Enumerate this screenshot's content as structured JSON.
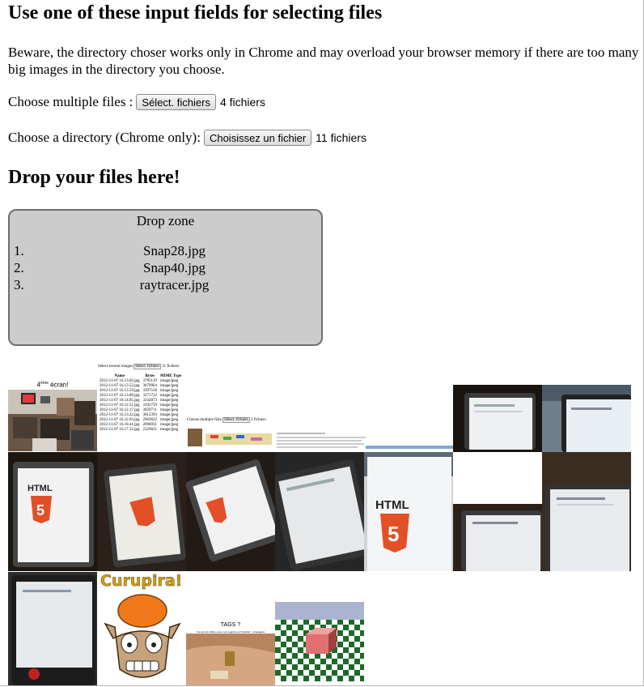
{
  "heading": "Use one of these input fields for selecting files",
  "warning": "Beware, the directory choser works only in Chrome and may overload your browser memory if there are too many big images in the directory you choose.",
  "multi": {
    "label": "Choose multiple files :",
    "button": "Sélect. fichiers",
    "count": "4 fichiers"
  },
  "dir": {
    "label": "Choose a directory (Chrome only):",
    "button": "Choisissez un fichier",
    "count": "11 fichiers"
  },
  "drop_heading": "Drop your files here!",
  "dropzone": {
    "title": "Drop zone",
    "files": [
      "Snap28.jpg",
      "Snap40.jpg",
      "raytracer.jpg"
    ]
  },
  "thumbnails": {
    "ecran": {
      "caption_pre": "4",
      "caption_sup": "ème",
      "caption_post": " écran!"
    },
    "table": {
      "top_label": "Select several images",
      "top_button": "Sélect. fichiers",
      "top_count": "11 fichiers",
      "headers": [
        "Name",
        "Bytes",
        "MIME Type"
      ],
      "rows": [
        [
          "2012-11-07 16.13.02.jpg",
          "3795119",
          "image/jpeg"
        ],
        [
          "2012-11-07 16.13.52.jpg",
          "3679964",
          "image/jpeg"
        ],
        [
          "2012-11-07 16.13.59.jpg",
          "3397518",
          "image/jpeg"
        ],
        [
          "2012-11-07 16.13.00.jpg",
          "3271722",
          "image/jpeg"
        ],
        [
          "2012-11-07 16.14.05.jpg",
          "3242873",
          "image/jpeg"
        ],
        [
          "2012-11-07 16.12.51.jpg",
          "3192759",
          "image/jpeg"
        ],
        [
          "2012-11-07 16.12.17.jpg",
          "3059711",
          "image/jpeg"
        ],
        [
          "2012-11-07 16.13.22.jpg",
          "3012393",
          "image/jpeg"
        ],
        [
          "2012-11-07 16.12.03.jpg",
          "2963622",
          "image/jpeg"
        ],
        [
          "2012-11-07 16.18.41.jpg",
          "2696931",
          "image/jpeg"
        ],
        [
          "2012-11-07 16.17.22.jpg",
          "2329621",
          "image/jpeg"
        ]
      ]
    },
    "choose": {
      "label": "Choose multiple files",
      "button": "Sélect. fichiers",
      "count": "2 fichiers"
    },
    "html5_label": "HTML",
    "curupira": "Curupira!",
    "tags": "TAGS ?",
    "tags_sub": "\"Ce qui est visible ouvre nos regards sur l'invisible\" - Anaxagore"
  },
  "colors": {
    "html5_orange": "#e34f26",
    "dropzone_bg": "#cccccc",
    "curupira_gold": "#d4a017"
  }
}
